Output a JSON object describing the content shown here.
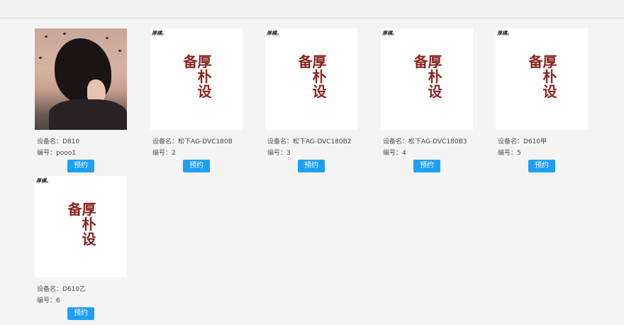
{
  "labels": {
    "name_prefix": "设备名：",
    "id_prefix": "编号："
  },
  "devices": [
    {
      "name": "D810",
      "id": "pooo1",
      "image": "photo",
      "button": "预约"
    },
    {
      "name": "松下AG-DVC180B",
      "id": "2",
      "image": "logo",
      "button": "预约"
    },
    {
      "name": "松下AG-DVC180B2",
      "id": "3",
      "image": "logo",
      "button": "预约"
    },
    {
      "name": "松下AG-DVC180B3",
      "id": "4",
      "image": "logo",
      "button": "预约"
    },
    {
      "name": "D610甲",
      "id": "5",
      "image": "logo",
      "button": "预约"
    },
    {
      "name": "D610乙",
      "id": "6",
      "image": "logo",
      "button": "预约"
    }
  ],
  "logo": {
    "main": "厚朴设备",
    "corner": "厚樸。"
  },
  "colors": {
    "button": "#1e9ff2",
    "logo_text": "#8a2420"
  }
}
